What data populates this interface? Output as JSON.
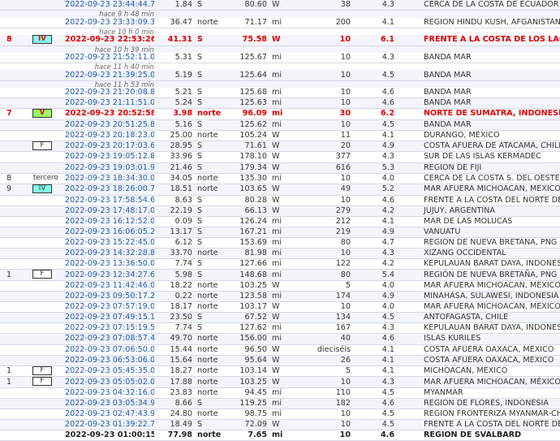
{
  "rows": [
    {
      "felt": "",
      "mmi": "",
      "date": "2022-09-23 23:44:44.7",
      "lat": "1.84",
      "ns": "S",
      "lon": "80.60",
      "ew": "W",
      "depth": "38",
      "mag": "4.3",
      "region": "CERCA DE LA COSTA DE ECUADOR",
      "ago": "hace 9 h 48 min"
    },
    {
      "felt": "",
      "mmi": "",
      "date": "2022-09-23 23:33:09.3",
      "lat": "36.47",
      "ns": "norte",
      "lon": "71.17",
      "ew": "mi",
      "depth": "200",
      "mag": "4.1",
      "region": "REGIÓN HINDÚ KUSH, AFGANISTÁN",
      "ago": "hace 10 h 0 min"
    },
    {
      "felt": "8",
      "mmi": "IV",
      "date": "2022-09-23 22:53:26.8",
      "lat": "41.31",
      "ns": "S",
      "lon": "75.58",
      "ew": "W",
      "depth": "10",
      "mag": "6.1",
      "region": "FRENTE A LA COSTA DE LOS LAGOS, CHILE",
      "ago": "hace 10 h 39 min",
      "hl": "red"
    },
    {
      "felt": "",
      "mmi": "",
      "date": "2022-09-23 21:52:11.0",
      "lat": "5.31",
      "ns": "S",
      "lon": "125.67",
      "ew": "mi",
      "depth": "10",
      "mag": "4.3",
      "region": "BANDA MAR",
      "ago": "hace 11 h 40 min"
    },
    {
      "felt": "",
      "mmi": "",
      "date": "2022-09-23 21:39:25.0",
      "lat": "5.19",
      "ns": "S",
      "lon": "125.64",
      "ew": "mi",
      "depth": "10",
      "mag": "4.5",
      "region": "BANDA MAR",
      "ago": "hace 11 h 53 min"
    },
    {
      "felt": "",
      "mmi": "",
      "date": "2022-09-23 21:20:08.8",
      "lat": "5.21",
      "ns": "S",
      "lon": "125.68",
      "ew": "mi",
      "depth": "10",
      "mag": "4.6",
      "region": "BANDA MAR"
    },
    {
      "felt": "",
      "mmi": "",
      "date": "2022-09-23 21:11:51.0",
      "lat": "5.24",
      "ns": "S",
      "lon": "125.63",
      "ew": "mi",
      "depth": "10",
      "mag": "4.6",
      "region": "BANDA MAR"
    },
    {
      "felt": "7",
      "mmi": "V",
      "date": "2022-09-23 20:52:58.1",
      "lat": "3.98",
      "ns": "norte",
      "lon": "96.09",
      "ew": "mi",
      "depth": "30",
      "mag": "6.2",
      "region": "NORTE DE SUMATRA, INDONESIA",
      "hl": "red"
    },
    {
      "felt": "",
      "mmi": "",
      "date": "2022-09-23 20:51:25.8",
      "lat": "5.16",
      "ns": "S",
      "lon": "125.62",
      "ew": "mi",
      "depth": "10",
      "mag": "4.5",
      "region": "BANDA MAR"
    },
    {
      "felt": "",
      "mmi": "",
      "date": "2022-09-23 20:18:23.0",
      "lat": "25.00",
      "ns": "norte",
      "lon": "105.24",
      "ew": "W",
      "depth": "11",
      "mag": "4.1",
      "region": "DURANGO, MÉXICO"
    },
    {
      "felt": "",
      "mmi": "F",
      "date": "2022-09-23 20:17:03.6",
      "lat": "28.95",
      "ns": "S",
      "lon": "71.61",
      "ew": "W",
      "depth": "20",
      "mag": "4.9",
      "region": "COSTA AFUERA DE ATACAMA, CHILE"
    },
    {
      "felt": "",
      "mmi": "",
      "date": "2022-09-23 19:05:12.8",
      "lat": "33.96",
      "ns": "S",
      "lon": "178.10",
      "ew": "W",
      "depth": "377",
      "mag": "4.3",
      "region": "SUR DE LAS ISLAS KERMADEC"
    },
    {
      "felt": "",
      "mmi": "",
      "date": "2022-09-23 19:03:01.9",
      "lat": "21.46",
      "ns": "S",
      "lon": "179.34",
      "ew": "W",
      "depth": "616",
      "mag": "5.3",
      "region": "REGIÓN DE FIJI"
    },
    {
      "felt": "8",
      "mmi": "tercero",
      "date": "2022-09-23 18:34:30.0",
      "lat": "34.05",
      "ns": "norte",
      "lon": "135.30",
      "ew": "mi",
      "depth": "10",
      "mag": "4.0",
      "region": "CERCA DE LA COSTA S. DEL OESTE DE HONSHU"
    },
    {
      "felt": "9",
      "mmi": "IV",
      "date": "2022-09-23 18:26:00.7",
      "lat": "18.51",
      "ns": "norte",
      "lon": "103.65",
      "ew": "W",
      "depth": "49",
      "mag": "5.2",
      "region": "MAR AFUERA MICHOACAN, MÉXICO"
    },
    {
      "felt": "",
      "mmi": "",
      "date": "2022-09-23 17:58:54.6",
      "lat": "8.63",
      "ns": "S",
      "lon": "80.28",
      "ew": "W",
      "depth": "10",
      "mag": "4.6",
      "region": "FRENTE A LA COSTA DEL NORTE DEL PERÚ"
    },
    {
      "felt": "",
      "mmi": "",
      "date": "2022-09-23 17:48:17.0",
      "lat": "22.19",
      "ns": "S",
      "lon": "66.13",
      "ew": "W",
      "depth": "279",
      "mag": "4.2",
      "region": "JUJUY, ARGENTINA"
    },
    {
      "felt": "",
      "mmi": "",
      "date": "2022-09-23 16:12:52.0",
      "lat": "0.09",
      "ns": "S",
      "lon": "126.24",
      "ew": "mi",
      "depth": "212",
      "mag": "4.1",
      "region": "MAR DE LAS MOLUCAS"
    },
    {
      "felt": "",
      "mmi": "",
      "date": "2022-09-23 16:06:05.2",
      "lat": "13.17",
      "ns": "S",
      "lon": "167.21",
      "ew": "mi",
      "depth": "219",
      "mag": "4.9",
      "region": "VANUATU"
    },
    {
      "felt": "",
      "mmi": "",
      "date": "2022-09-23 15:22:45.0",
      "lat": "6.12",
      "ns": "S",
      "lon": "153.69",
      "ew": "mi",
      "depth": "80",
      "mag": "4.7",
      "region": "REGIÓN DE NUEVA BRETAÑA, PNG"
    },
    {
      "felt": "",
      "mmi": "",
      "date": "2022-09-23 14:32:28.8",
      "lat": "33.70",
      "ns": "norte",
      "lon": "81.98",
      "ew": "mi",
      "depth": "10",
      "mag": "4.3",
      "region": "XIZANG OCCIDENTAL"
    },
    {
      "felt": "",
      "mmi": "",
      "date": "2022-09-23 13:36:50.0",
      "lat": "7.74",
      "ns": "S",
      "lon": "127.66",
      "ew": "mi",
      "depth": "122",
      "mag": "4.2",
      "region": "KEPULAUAN BARAT DAYA, INDONESIA"
    },
    {
      "felt": "1",
      "mmi": "F",
      "date": "2022-09-23 12:34:27.6",
      "lat": "5.98",
      "ns": "S",
      "lon": "148.68",
      "ew": "mi",
      "depth": "80",
      "mag": "5.4",
      "region": "REGIÓN DE NUEVA BRETAÑA, PNG"
    },
    {
      "felt": "",
      "mmi": "",
      "date": "2022-09-23 11:42:46.0",
      "lat": "18.22",
      "ns": "norte",
      "lon": "103.25",
      "ew": "W",
      "depth": "5",
      "mag": "4.0",
      "region": "MAR AFUERA MICHOACAN, MÉXICO"
    },
    {
      "felt": "",
      "mmi": "",
      "date": "2022-09-23 09:50:17.2",
      "lat": "0.22",
      "ns": "norte",
      "lon": "123.58",
      "ew": "mi",
      "depth": "174",
      "mag": "4.9",
      "region": "MINAHASA, SULAWESI, INDONESIA"
    },
    {
      "felt": "",
      "mmi": "",
      "date": "2022-09-23 07:57:19.0",
      "lat": "18.17",
      "ns": "norte",
      "lon": "103.17",
      "ew": "W",
      "depth": "10",
      "mag": "4.0",
      "region": "MAR AFUERA MICHOACAN, MÉXICO"
    },
    {
      "felt": "",
      "mmi": "",
      "date": "2022-09-23 07:49:15.1",
      "lat": "23.50",
      "ns": "S",
      "lon": "67.52",
      "ew": "W",
      "depth": "134",
      "mag": "4.5",
      "region": "ANTOFAGASTA, CHILE"
    },
    {
      "felt": "",
      "mmi": "",
      "date": "2022-09-23 07:15:19.5",
      "lat": "7.74",
      "ns": "S",
      "lon": "127.62",
      "ew": "mi",
      "depth": "167",
      "mag": "4.3",
      "region": "KEPULAUAN BARAT DAYA, INDONESIA"
    },
    {
      "felt": "",
      "mmi": "",
      "date": "2022-09-23 07:08:57.4",
      "lat": "49.70",
      "ns": "norte",
      "lon": "156.00",
      "ew": "mi",
      "depth": "40",
      "mag": "4.6",
      "region": "ISLAS KURILES"
    },
    {
      "felt": "",
      "mmi": "",
      "date": "2022-09-23 07:06:50.0",
      "lat": "15.44",
      "ns": "norte",
      "lon": "96.50",
      "ew": "W",
      "depth": "dieciséis",
      "mag": "4.1",
      "region": "COSTA AFUERA OAXACA, MÉXICO"
    },
    {
      "felt": "",
      "mmi": "",
      "date": "2022-09-23 06:53:06.0",
      "lat": "15.64",
      "ns": "norte",
      "lon": "95.64",
      "ew": "W",
      "depth": "26",
      "mag": "4.1",
      "region": "COSTA AFUERA OAXACA, MÉXICO"
    },
    {
      "felt": "1",
      "mmi": "F",
      "date": "2022-09-23 05:45:35.0",
      "lat": "18.27",
      "ns": "norte",
      "lon": "103.14",
      "ew": "W",
      "depth": "5",
      "mag": "4.1",
      "region": "MICHOACAN, MÉXICO"
    },
    {
      "felt": "1",
      "mmi": "F",
      "date": "2022-09-23 05:05:02.0",
      "lat": "17.88",
      "ns": "norte",
      "lon": "103.25",
      "ew": "W",
      "depth": "10",
      "mag": "4.3",
      "region": "MAR AFUERA MICHOACAN, MÉXICO"
    },
    {
      "felt": "",
      "mmi": "",
      "date": "2022-09-23 04:32:16.0",
      "lat": "23.83",
      "ns": "norte",
      "lon": "94.45",
      "ew": "mi",
      "depth": "110",
      "mag": "4.5",
      "region": "MYANMAR"
    },
    {
      "felt": "",
      "mmi": "",
      "date": "2022-09-23 03:05:34.9",
      "lat": "8.66",
      "ns": "S",
      "lon": "119.25",
      "ew": "mi",
      "depth": "182",
      "mag": "4.6",
      "region": "REGIÓN DE FLORES, INDONESIA"
    },
    {
      "felt": "",
      "mmi": "",
      "date": "2022-09-23 02:47:43.9",
      "lat": "24.80",
      "ns": "norte",
      "lon": "98.75",
      "ew": "mi",
      "depth": "10",
      "mag": "4.5",
      "region": "REGIÓN FRONTERIZA MYANMAR-CHINA"
    },
    {
      "felt": "",
      "mmi": "",
      "date": "2022-09-23 01:39:22.7",
      "lat": "18.49",
      "ns": "S",
      "lon": "72.09",
      "ew": "W",
      "depth": "10",
      "mag": "4.5",
      "region": "FRENTE A LA COSTA DEL NORTE DEL PERÚ"
    },
    {
      "felt": "",
      "mmi": "",
      "date": "2022-09-23 01:00:15.5",
      "lat": "77.98",
      "ns": "norte",
      "lon": "7.65",
      "ew": "mi",
      "depth": "10",
      "mag": "4.6",
      "region": "REGIÓN DE SVALBARD",
      "hl": "bold"
    }
  ]
}
